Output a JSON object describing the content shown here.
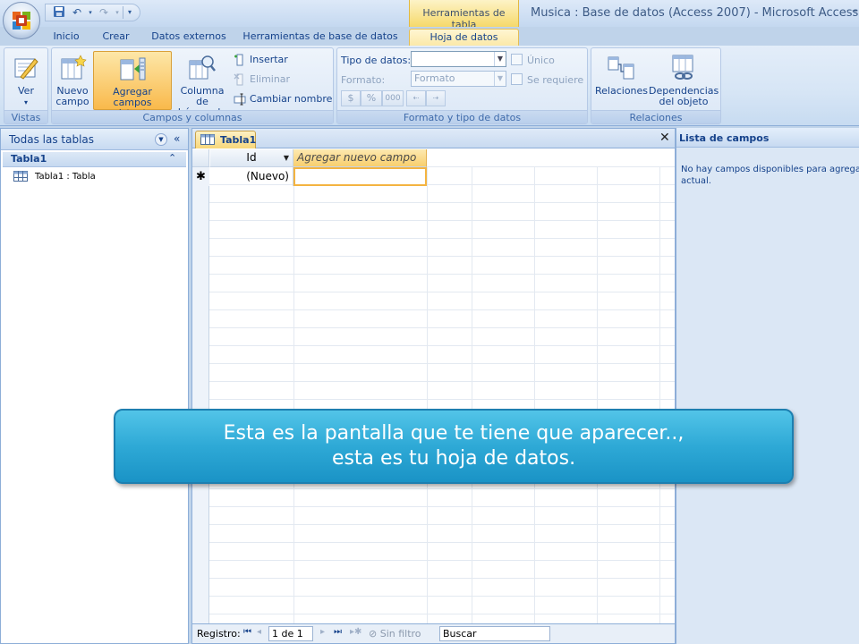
{
  "window": {
    "contextual_tab_header": "Herramientas de tabla",
    "title_document": "Musica : Base de datos (Access 2007)",
    "title_separator": "-",
    "title_app": "Microsoft Access",
    "minimize": "–"
  },
  "ribbon_tabs": [
    {
      "label": "Inicio"
    },
    {
      "label": "Crear"
    },
    {
      "label": "Datos externos"
    },
    {
      "label": "Herramientas de base de datos"
    },
    {
      "label": "Hoja de datos",
      "active": true
    }
  ],
  "ribbon": {
    "vistas": {
      "label": "Vistas",
      "ver_label": "Ver"
    },
    "campos": {
      "label": "Campos y columnas",
      "nuevo_campo": "Nuevo campo",
      "agregar_campos": "Agregar campos existentes",
      "columna_busqueda": "Columna de búsqueda",
      "insertar": "Insertar",
      "eliminar": "Eliminar",
      "cambiar_nombre": "Cambiar nombre"
    },
    "formato": {
      "label": "Formato y tipo de datos",
      "tipo_datos_label": "Tipo de datos:",
      "tipo_datos_value": "",
      "formato_label": "Formato:",
      "formato_value": "Formato",
      "unico": "Único",
      "se_requiere": "Se requiere",
      "currency": "$",
      "percent": "%",
      "thousands": "000"
    },
    "relaciones": {
      "label": "Relaciones",
      "relaciones": "Relaciones",
      "dependencias": "Dependencias del objeto"
    }
  },
  "nav_pane": {
    "title": "Todas las tablas",
    "group": "Tabla1",
    "items": [
      {
        "label": "Tabla1 : Tabla"
      }
    ]
  },
  "document": {
    "tab_label": "Tabla1",
    "close": "✕",
    "columns": [
      {
        "label": "Id"
      },
      {
        "label": "Agregar nuevo campo"
      }
    ],
    "new_row_marker": "✱",
    "new_row_value": "(Nuevo)"
  },
  "status": {
    "registro_label": "Registro:",
    "page": "1 de 1",
    "filter": "Sin filtro",
    "search": "Buscar"
  },
  "field_list": {
    "title": "Lista de campos",
    "message_line1": "No hay campos disponibles para agregar",
    "message_line2": "actual."
  },
  "callout": {
    "line1": "Esta es la pantalla que te tiene que aparecer..,",
    "line2": "esta es tu hoja de datos."
  }
}
